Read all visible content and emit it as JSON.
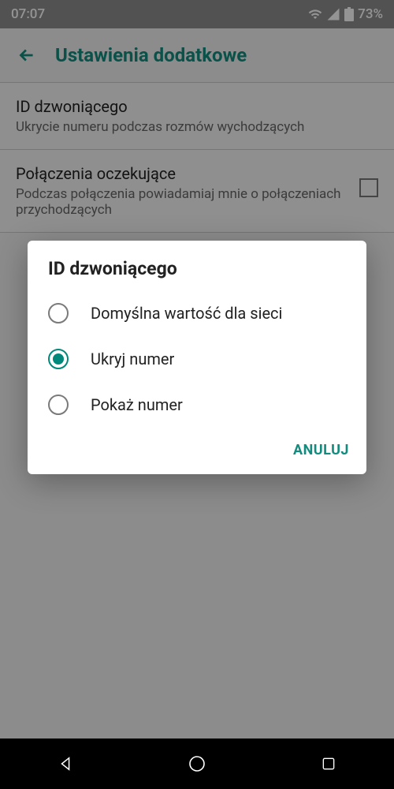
{
  "statusbar": {
    "time": "07:07",
    "battery": "73%"
  },
  "appbar": {
    "title": "Ustawienia dodatkowe"
  },
  "settings": {
    "caller_id": {
      "title": "ID dzwoniącego",
      "sub": "Ukrycie numeru podczas rozmów wychodzących"
    },
    "call_waiting": {
      "title": "Połączenia oczekujące",
      "sub": "Podczas połączenia powiadamiaj mnie o połączeniach przychodzących"
    }
  },
  "dialog": {
    "title": "ID dzwoniącego",
    "options": {
      "default": "Domyślna wartość dla sieci",
      "hide": "Ukryj numer",
      "show": "Pokaż numer"
    },
    "cancel": "ANULUJ"
  }
}
